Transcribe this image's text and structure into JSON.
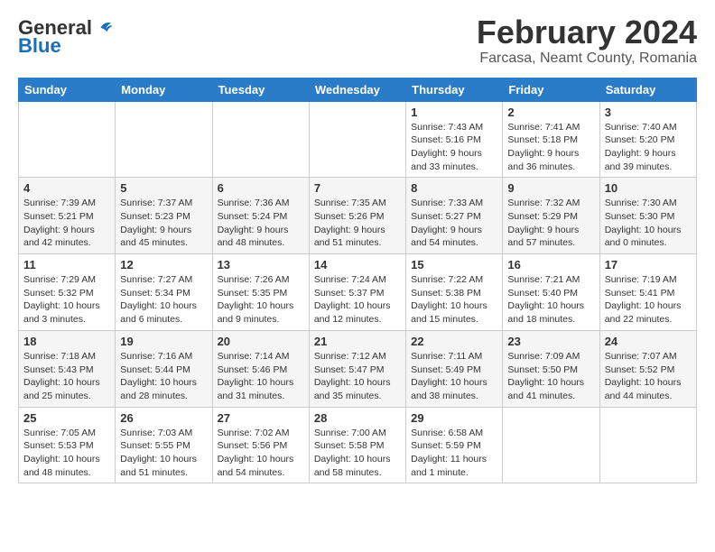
{
  "header": {
    "logo_general": "General",
    "logo_blue": "Blue",
    "main_title": "February 2024",
    "subtitle": "Farcasa, Neamt County, Romania"
  },
  "calendar": {
    "days_of_week": [
      "Sunday",
      "Monday",
      "Tuesday",
      "Wednesday",
      "Thursday",
      "Friday",
      "Saturday"
    ],
    "weeks": [
      [
        {
          "day": "",
          "info": ""
        },
        {
          "day": "",
          "info": ""
        },
        {
          "day": "",
          "info": ""
        },
        {
          "day": "",
          "info": ""
        },
        {
          "day": "1",
          "info": "Sunrise: 7:43 AM\nSunset: 5:16 PM\nDaylight: 9 hours\nand 33 minutes."
        },
        {
          "day": "2",
          "info": "Sunrise: 7:41 AM\nSunset: 5:18 PM\nDaylight: 9 hours\nand 36 minutes."
        },
        {
          "day": "3",
          "info": "Sunrise: 7:40 AM\nSunset: 5:20 PM\nDaylight: 9 hours\nand 39 minutes."
        }
      ],
      [
        {
          "day": "4",
          "info": "Sunrise: 7:39 AM\nSunset: 5:21 PM\nDaylight: 9 hours\nand 42 minutes."
        },
        {
          "day": "5",
          "info": "Sunrise: 7:37 AM\nSunset: 5:23 PM\nDaylight: 9 hours\nand 45 minutes."
        },
        {
          "day": "6",
          "info": "Sunrise: 7:36 AM\nSunset: 5:24 PM\nDaylight: 9 hours\nand 48 minutes."
        },
        {
          "day": "7",
          "info": "Sunrise: 7:35 AM\nSunset: 5:26 PM\nDaylight: 9 hours\nand 51 minutes."
        },
        {
          "day": "8",
          "info": "Sunrise: 7:33 AM\nSunset: 5:27 PM\nDaylight: 9 hours\nand 54 minutes."
        },
        {
          "day": "9",
          "info": "Sunrise: 7:32 AM\nSunset: 5:29 PM\nDaylight: 9 hours\nand 57 minutes."
        },
        {
          "day": "10",
          "info": "Sunrise: 7:30 AM\nSunset: 5:30 PM\nDaylight: 10 hours\nand 0 minutes."
        }
      ],
      [
        {
          "day": "11",
          "info": "Sunrise: 7:29 AM\nSunset: 5:32 PM\nDaylight: 10 hours\nand 3 minutes."
        },
        {
          "day": "12",
          "info": "Sunrise: 7:27 AM\nSunset: 5:34 PM\nDaylight: 10 hours\nand 6 minutes."
        },
        {
          "day": "13",
          "info": "Sunrise: 7:26 AM\nSunset: 5:35 PM\nDaylight: 10 hours\nand 9 minutes."
        },
        {
          "day": "14",
          "info": "Sunrise: 7:24 AM\nSunset: 5:37 PM\nDaylight: 10 hours\nand 12 minutes."
        },
        {
          "day": "15",
          "info": "Sunrise: 7:22 AM\nSunset: 5:38 PM\nDaylight: 10 hours\nand 15 minutes."
        },
        {
          "day": "16",
          "info": "Sunrise: 7:21 AM\nSunset: 5:40 PM\nDaylight: 10 hours\nand 18 minutes."
        },
        {
          "day": "17",
          "info": "Sunrise: 7:19 AM\nSunset: 5:41 PM\nDaylight: 10 hours\nand 22 minutes."
        }
      ],
      [
        {
          "day": "18",
          "info": "Sunrise: 7:18 AM\nSunset: 5:43 PM\nDaylight: 10 hours\nand 25 minutes."
        },
        {
          "day": "19",
          "info": "Sunrise: 7:16 AM\nSunset: 5:44 PM\nDaylight: 10 hours\nand 28 minutes."
        },
        {
          "day": "20",
          "info": "Sunrise: 7:14 AM\nSunset: 5:46 PM\nDaylight: 10 hours\nand 31 minutes."
        },
        {
          "day": "21",
          "info": "Sunrise: 7:12 AM\nSunset: 5:47 PM\nDaylight: 10 hours\nand 35 minutes."
        },
        {
          "day": "22",
          "info": "Sunrise: 7:11 AM\nSunset: 5:49 PM\nDaylight: 10 hours\nand 38 minutes."
        },
        {
          "day": "23",
          "info": "Sunrise: 7:09 AM\nSunset: 5:50 PM\nDaylight: 10 hours\nand 41 minutes."
        },
        {
          "day": "24",
          "info": "Sunrise: 7:07 AM\nSunset: 5:52 PM\nDaylight: 10 hours\nand 44 minutes."
        }
      ],
      [
        {
          "day": "25",
          "info": "Sunrise: 7:05 AM\nSunset: 5:53 PM\nDaylight: 10 hours\nand 48 minutes."
        },
        {
          "day": "26",
          "info": "Sunrise: 7:03 AM\nSunset: 5:55 PM\nDaylight: 10 hours\nand 51 minutes."
        },
        {
          "day": "27",
          "info": "Sunrise: 7:02 AM\nSunset: 5:56 PM\nDaylight: 10 hours\nand 54 minutes."
        },
        {
          "day": "28",
          "info": "Sunrise: 7:00 AM\nSunset: 5:58 PM\nDaylight: 10 hours\nand 58 minutes."
        },
        {
          "day": "29",
          "info": "Sunrise: 6:58 AM\nSunset: 5:59 PM\nDaylight: 11 hours\nand 1 minute."
        },
        {
          "day": "",
          "info": ""
        },
        {
          "day": "",
          "info": ""
        }
      ]
    ]
  }
}
